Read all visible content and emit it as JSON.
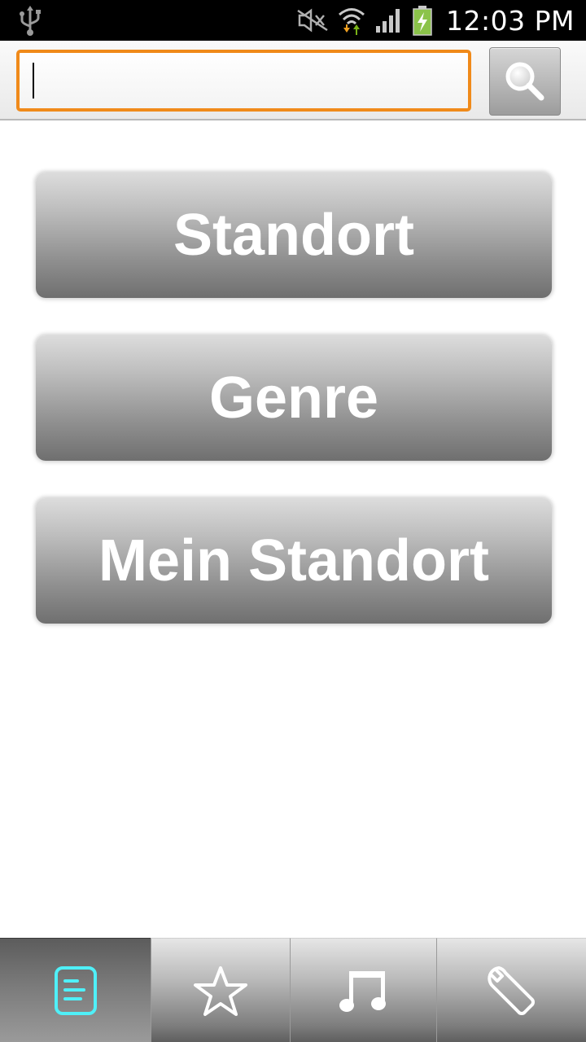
{
  "status_bar": {
    "time": "12:03 PM",
    "icons": [
      "usb-icon",
      "mute-icon",
      "wifi-icon",
      "signal-icon",
      "battery-charging-icon"
    ],
    "colors": {
      "wifi_arrow_up": "#7ab317",
      "wifi_arrow_down": "#f0a020",
      "battery": "#8bc34a"
    }
  },
  "search": {
    "value": "",
    "placeholder": "",
    "button_icon": "magnifier-icon",
    "accent_color": "#f08a1a"
  },
  "menu": {
    "buttons": [
      {
        "label": "Standort"
      },
      {
        "label": "Genre"
      },
      {
        "label": "Mein Standort"
      }
    ]
  },
  "tabs": [
    {
      "icon": "list-icon",
      "active": true,
      "icon_color": "#4ff0f8"
    },
    {
      "icon": "star-icon",
      "active": false
    },
    {
      "icon": "music-note-icon",
      "active": false
    },
    {
      "icon": "wrench-icon",
      "active": false
    }
  ]
}
